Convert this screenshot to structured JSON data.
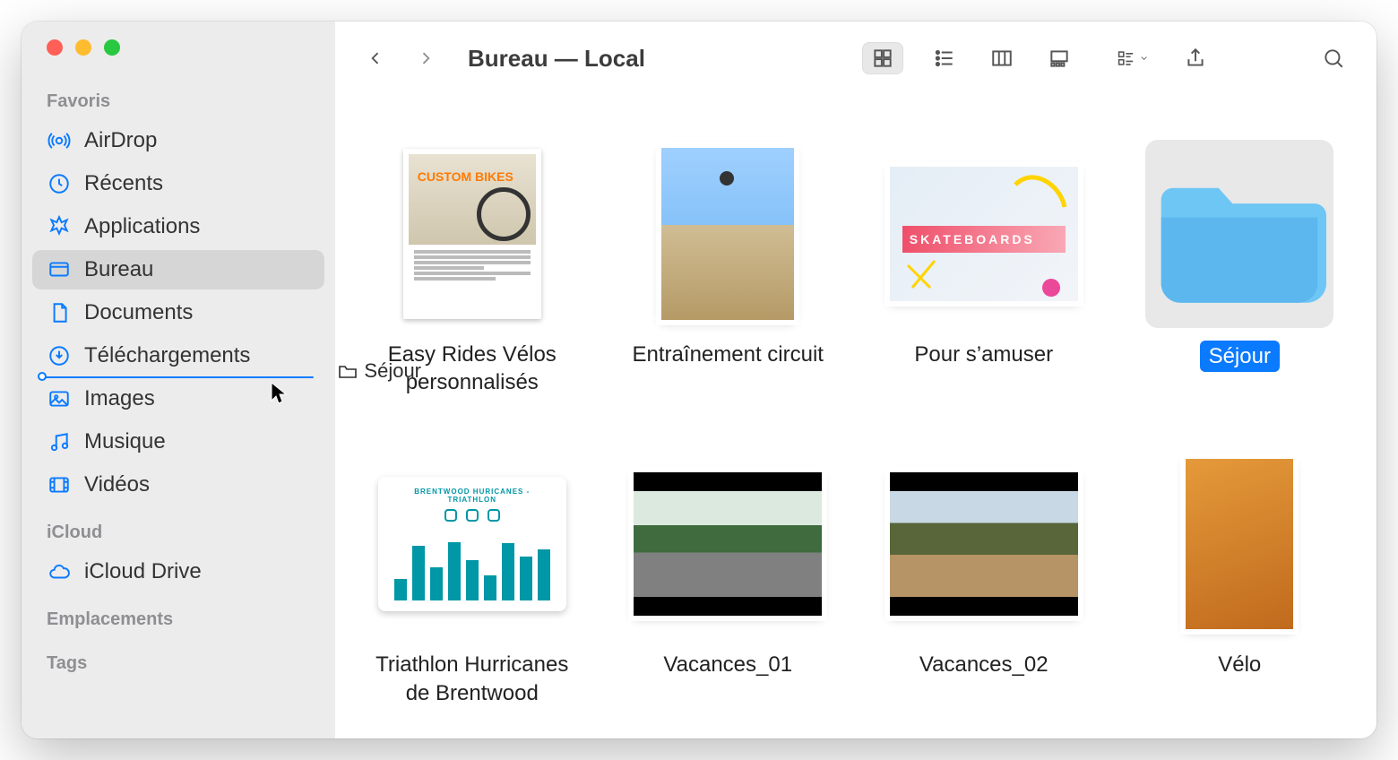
{
  "sidebar": {
    "sections": {
      "favoris": "Favoris",
      "icloud": "iCloud",
      "emplacements": "Emplacements",
      "tags": "Tags"
    },
    "items": [
      {
        "label": "AirDrop",
        "icon": "airdrop"
      },
      {
        "label": "Récents",
        "icon": "clock"
      },
      {
        "label": "Applications",
        "icon": "appstore"
      },
      {
        "label": "Bureau",
        "icon": "desktop",
        "active": true
      },
      {
        "label": "Documents",
        "icon": "document"
      },
      {
        "label": "Téléchargements",
        "icon": "download"
      },
      {
        "label": "Images",
        "icon": "image"
      },
      {
        "label": "Musique",
        "icon": "music"
      },
      {
        "label": "Vidéos",
        "icon": "video"
      }
    ],
    "icloud_items": [
      {
        "label": "iCloud Drive",
        "icon": "cloud"
      }
    ]
  },
  "header": {
    "title": "Bureau — Local"
  },
  "drag": {
    "label": "Séjour"
  },
  "items": [
    {
      "name": "Easy Rides Vélos personnalisés",
      "kind": "doc-bikes"
    },
    {
      "name": "Entraînement circuit",
      "kind": "photo-bmx"
    },
    {
      "name": "Pour s’amuser",
      "kind": "photo-skate"
    },
    {
      "name": "Séjour",
      "kind": "folder",
      "selected": true
    },
    {
      "name": "Triathlon Hurricanes de Brentwood",
      "kind": "slide"
    },
    {
      "name": "Vacances_01",
      "kind": "video1"
    },
    {
      "name": "Vacances_02",
      "kind": "video2"
    },
    {
      "name": "Vélo",
      "kind": "photo-sunset"
    }
  ],
  "thumb_text": {
    "custom_bikes": "CUSTOM BIKES",
    "skate_banner": "SKATEBOARDS",
    "slide_title": "BRENTWOOD HURICANES - TRIATHLON"
  }
}
